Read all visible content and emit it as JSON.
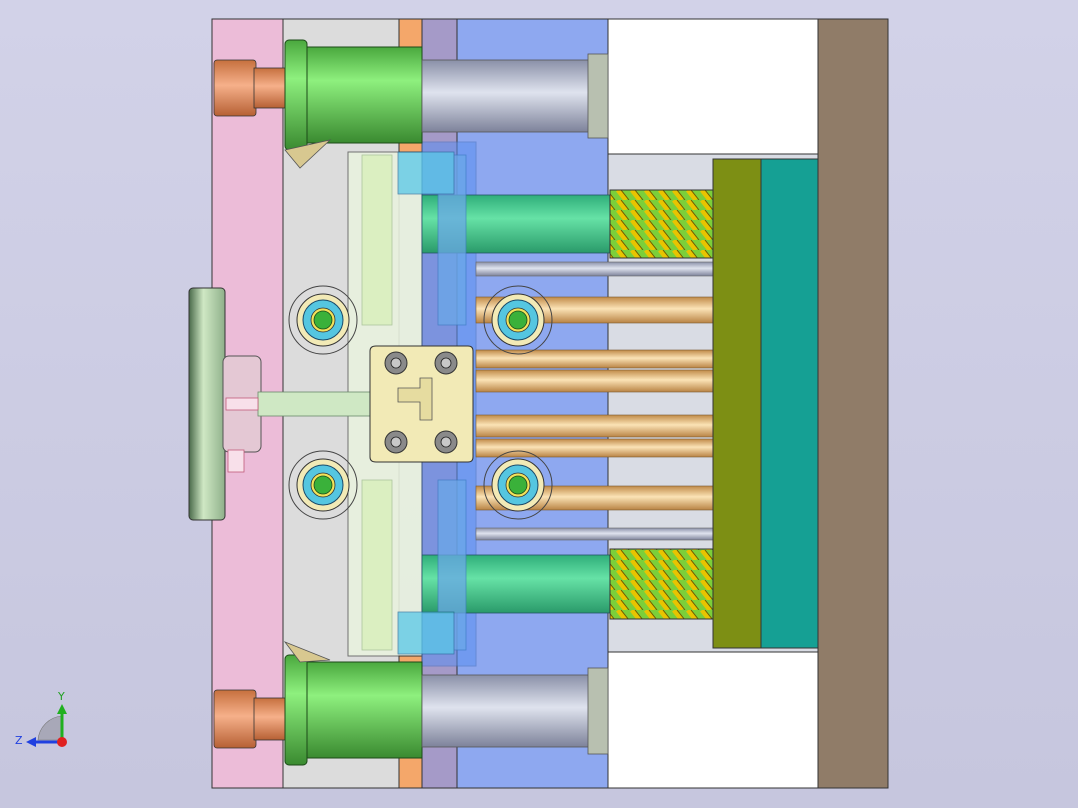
{
  "viewport": {
    "background_top": "#d2d2e8",
    "background_bottom": "#c6c6de"
  },
  "colors": {
    "clamp_plate": "#ecbcd8",
    "a_plate": "#dcdcdc",
    "orange_strip": "#f4a76a",
    "purple_strip": "#a59ac8",
    "b_plate": "#8ea8f0",
    "white_block": "#ffffff",
    "ejector_plate": "#7d8f14",
    "ejector_retainer": "#15a094",
    "back_plate": "#907c68",
    "guide_pillar": "#7be36f",
    "spring": "#c9b400",
    "return_pin": "#5ad79a",
    "bolt_ring": "#55c6e0",
    "bolt_center": "#3ab13a",
    "locator": "#f2eab6",
    "sprue_bushing": "#cfe8c4",
    "axis_x": "#e02020",
    "axis_y": "#20b020",
    "axis_z": "#2040e0"
  },
  "axis_triad": {
    "y_label": "Y",
    "z_label": "Z"
  }
}
